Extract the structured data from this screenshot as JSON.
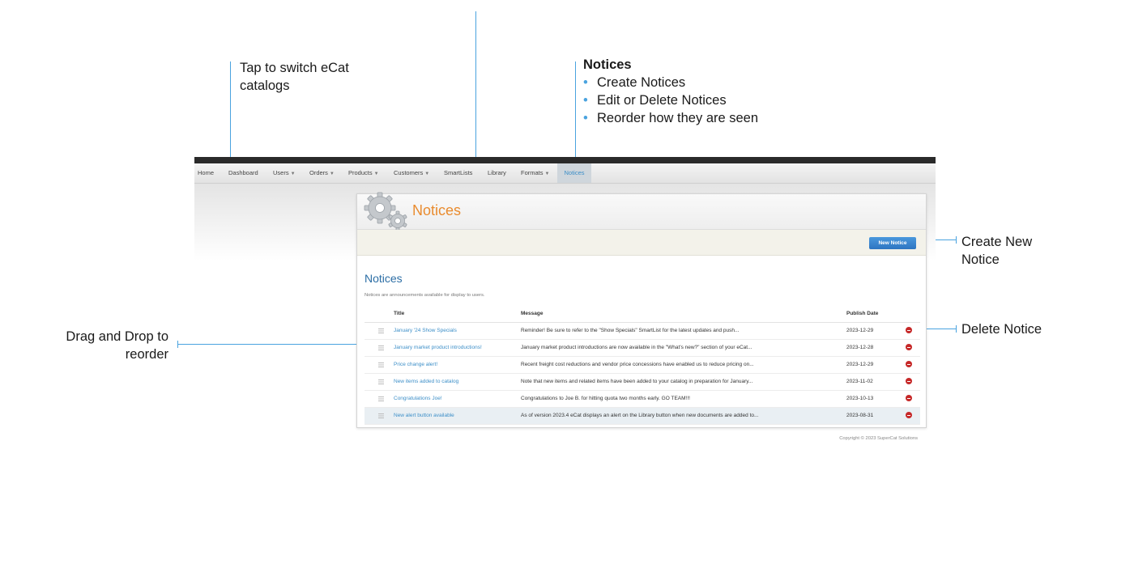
{
  "annotations": {
    "catalogs": {
      "text": "Tap to switch eCat catalogs"
    },
    "notices": {
      "title": "Notices",
      "bullets": [
        "Create Notices",
        "Edit or Delete Notices",
        "Reorder how they are seen"
      ]
    },
    "create_new": {
      "text": "Create New Notice"
    },
    "delete": {
      "text": "Delete Notice"
    },
    "drag_drop": {
      "text": "Drag and Drop to reorder"
    }
  },
  "nav": {
    "items": [
      {
        "label": "Home",
        "has_caret": false,
        "active": false
      },
      {
        "label": "Dashboard",
        "has_caret": false,
        "active": false
      },
      {
        "label": "Users",
        "has_caret": true,
        "active": false
      },
      {
        "label": "Orders",
        "has_caret": true,
        "active": false
      },
      {
        "label": "Products",
        "has_caret": true,
        "active": false
      },
      {
        "label": "Customers",
        "has_caret": true,
        "active": false
      },
      {
        "label": "SmartLists",
        "has_caret": false,
        "active": false
      },
      {
        "label": "Library",
        "has_caret": false,
        "active": false
      },
      {
        "label": "Formats",
        "has_caret": true,
        "active": false
      },
      {
        "label": "Notices",
        "has_caret": false,
        "active": true
      }
    ]
  },
  "panel": {
    "title": "Notices",
    "new_button": "New Notice",
    "section_title": "Notices",
    "description": "Notices are announcements available for display to users."
  },
  "table": {
    "headers": {
      "title": "Title",
      "message": "Message",
      "date": "Publish Date"
    },
    "rows": [
      {
        "title": "January '24 Show Specials",
        "message": "Reminder! Be sure to refer to the \"Show Specials\" SmartList for the latest updates and push...",
        "date": "2023-12-29"
      },
      {
        "title": "January market product introductions!",
        "message": "January market product introductions are now available in the \"What's new?\" section of your eCat...",
        "date": "2023-12-28"
      },
      {
        "title": "Price change alert!",
        "message": "Recent freight cost reductions and vendor price concessions have enabled us to reduce pricing on...",
        "date": "2023-12-29"
      },
      {
        "title": "New items added to catalog",
        "message": "Note that new items and related items have been added to your catalog in preparation for January...",
        "date": "2023-11-02"
      },
      {
        "title": "Congratulations Joe!",
        "message": "Congratulations to Joe B. for hitting quota two months early. GO TEAM!!!",
        "date": "2023-10-13"
      },
      {
        "title": "New alert button available",
        "message": "As of version 2023.4 eCat displays an alert on the Library button when new documents are added to...",
        "date": "2023-08-31"
      }
    ]
  },
  "footer": {
    "copyright": "Copyright © 2023 SuperCat Solutions"
  },
  "colors": {
    "accent": "#4aa3df",
    "title_orange": "#e98b2e",
    "link": "#3d8fc8",
    "delete": "#c62828",
    "button": "#2d75c1"
  }
}
